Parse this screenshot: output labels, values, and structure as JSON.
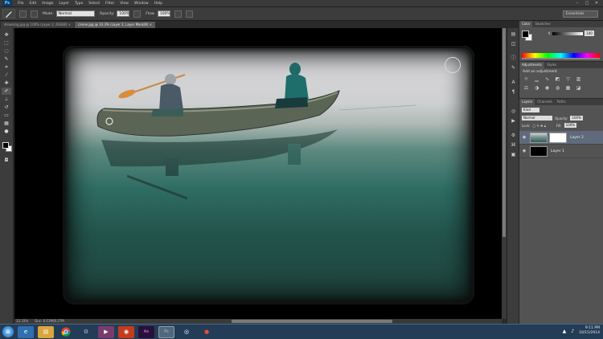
{
  "app": {
    "logo": "Ps",
    "menus": [
      "File",
      "Edit",
      "Image",
      "Layer",
      "Type",
      "Select",
      "Filter",
      "View",
      "Window",
      "Help"
    ],
    "window_controls": [
      "–",
      "□",
      "✕"
    ]
  },
  "options": {
    "mode_label": "Mode:",
    "mode_value": "Normal",
    "opacity_label": "Opacity:",
    "opacity_value": "100%",
    "flow_label": "Flow:",
    "flow_value": "100%",
    "workspace": "Essentials"
  },
  "tabs": [
    {
      "label": "drowning.jpg @ 100% (Layer 2, RGB/8) ×",
      "active": false
    },
    {
      "label": "canoe.jpg @ 33.3% (Layer 2, Layer Mask/8) ×",
      "active": true
    }
  ],
  "status": {
    "zoom": "33.33%",
    "doc": "Doc: 6.01M/8.27M"
  },
  "color_panel": {
    "tabs": [
      "Color",
      "Swatches"
    ],
    "slider_label": "K",
    "slider_value": "100"
  },
  "adjustments": {
    "tabs": [
      "Adjustments",
      "Styles"
    ],
    "title": "Add an adjustment"
  },
  "layers": {
    "tabs": [
      "Layers",
      "Channels",
      "Paths"
    ],
    "kind_label": "Kind",
    "blend_mode": "Normal",
    "opacity_label": "Opacity:",
    "opacity_value": "100%",
    "lock_label": "Lock:",
    "fill_label": "Fill:",
    "fill_value": "100%",
    "items": [
      {
        "name": "Layer 2",
        "active": true
      },
      {
        "name": "Layer 1",
        "active": false
      }
    ]
  },
  "taskbar": {
    "time": "9:11 PM",
    "date": "10/15/2014"
  },
  "colors": {
    "accent": "#5f6b7c",
    "taskbar": "#233d57"
  }
}
